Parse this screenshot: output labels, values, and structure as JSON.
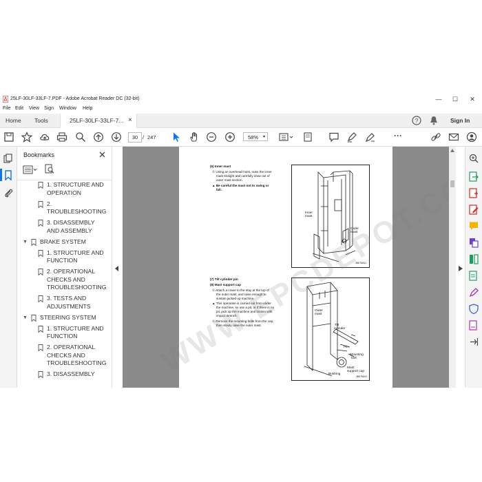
{
  "window": {
    "title": "25LF-30LF-33LF-7.PDF - Adobe Acrobat Reader DC (32-bit)",
    "controls": {
      "minimize": "—",
      "maximize": "☐",
      "close": "✕"
    }
  },
  "menu": [
    "File",
    "Edit",
    "View",
    "Sign",
    "Window",
    "Help"
  ],
  "tabs": {
    "home": "Home",
    "tools": "Tools",
    "document": "25LF-30LF-33LF-7...",
    "close": "×"
  },
  "topright": {
    "help_icon": "?",
    "sign_in": "Sign In"
  },
  "toolbar": {
    "page_current": "30",
    "page_separator": "/",
    "page_total": "247",
    "zoom": "58%",
    "more": "···"
  },
  "bookmarks": {
    "title": "Bookmarks",
    "items": [
      {
        "label_1": "1. STRUCTURE AND",
        "label_2": "OPERATION",
        "level": 2
      },
      {
        "label_1": "2.",
        "label_2": "TROUBLESHOOTING",
        "level": 2
      },
      {
        "label_1": "3. DISASSEMBLY",
        "label_2": "AND ASSEMBLY",
        "level": 2
      },
      {
        "label_1": "BRAKE SYSTEM",
        "level": 1
      },
      {
        "label_1": "1. STRUCTURE AND",
        "label_2": "FUNCTION",
        "level": 2
      },
      {
        "label_1": "2. OPERATIONAL",
        "label_2": "CHECKS AND",
        "label_3": "TROUBLESHOOTING",
        "level": 2
      },
      {
        "label_1": "3. TESTS AND",
        "label_2": "ADJUSTMENTS",
        "level": 2
      },
      {
        "label_1": "STEERING SYSTEM",
        "level": 1
      },
      {
        "label_1": "1. STRUCTURE AND",
        "label_2": "FUNCTION",
        "level": 2
      },
      {
        "label_1": "2. OPERATIONAL",
        "label_2": "CHECKS AND",
        "label_3": "TROUBLESHOOTING",
        "level": 2
      },
      {
        "label_1": "3. DISASSEMBLY",
        "level": 2
      }
    ]
  },
  "page": {
    "section6_title": "(6) Inner mast",
    "section6_step1": "① Using an overhead hoist, raise the inner",
    "section6_step1b": "mast straight and carefully draw out of",
    "section6_step1c": "outer mast section.",
    "section6_warn": "▲ Be careful the mast not to swing or",
    "section6_warn_b": "fall.",
    "fig1_labels": {
      "inner": "Inner",
      "inner2": "mast",
      "outer": "Outer",
      "outer2": "mast",
      "code": "3BD7MA11"
    },
    "section7_title": "(7) Tilt cylinder pin",
    "section8_title": "(8) Mast support cap",
    "section8_step1": "① Attach a crane to the stay at the top of",
    "section8_step1b": "the outer mast, and raise enough to",
    "section8_step1c": "sustain jacked up machine.",
    "section8_note": "▲ This operation is carried out from under",
    "section8_note_b": "the machine, so use a pit, or if there is no",
    "section8_note_c": "pit, jack up the machine and loosen with",
    "section8_note_d": "impact wrench.",
    "section8_step2": "② Remove the mounting bolts from the cap,",
    "section8_step2b": "then slowly raise the outer mast.",
    "fig2_labels": {
      "outer": "Outer",
      "outer2": "mast",
      "tilt": "Tilt",
      "tilt2": "cylinder",
      "pin": "Pin",
      "mounting": "Mounting",
      "mounting2": "bolt",
      "support": "Mast",
      "support2": "support cap",
      "bushing": "Bushing",
      "code": "3BD7MA12"
    },
    "watermark": "WWW.EPCDEPOT.COM"
  },
  "colors": {
    "pdf_red": "#d7261f",
    "accent_blue": "#1473e6",
    "doc_bg": "#8a8a8a"
  }
}
